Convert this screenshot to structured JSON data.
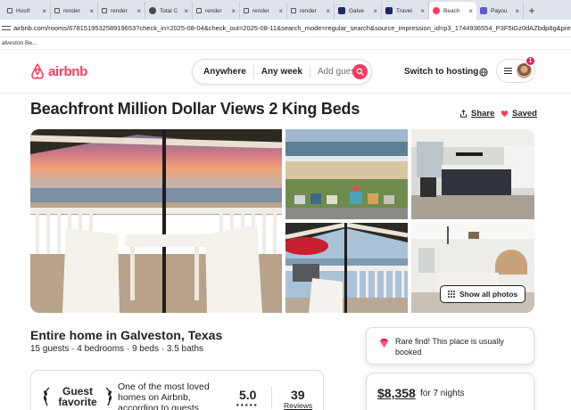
{
  "browser": {
    "tabs": [
      {
        "title": "Hostf",
        "icon": "lock-icon",
        "active": false
      },
      {
        "title": "render",
        "icon": "lock-icon",
        "active": false
      },
      {
        "title": "render",
        "icon": "lock-icon",
        "active": false
      },
      {
        "title": "Total C",
        "icon": "globe-icon",
        "active": false
      },
      {
        "title": "render",
        "icon": "lock-icon",
        "active": false
      },
      {
        "title": "render",
        "icon": "lock-icon",
        "active": false
      },
      {
        "title": "render",
        "icon": "lock-icon",
        "active": false
      },
      {
        "title": "Galve",
        "icon": "navy-logo-icon",
        "active": false
      },
      {
        "title": "Travel",
        "icon": "navy-logo-icon",
        "active": false
      },
      {
        "title": "Beach",
        "icon": "airbnb-icon",
        "active": true
      },
      {
        "title": "Payou",
        "icon": "v-logo-icon",
        "active": false
      }
    ],
    "url": "airbnb.com/rooms/678151953258919653?check_in=2025-08-04&check_out=2025-08-11&search_mode=regular_search&source_impression_id=p3_1744936554_P3F5iGz0dAZbdp8g&previous_pa...",
    "bookmark": "alveston Be..."
  },
  "header": {
    "logo_text": "airbnb",
    "search": {
      "anywhere": "Anywhere",
      "week": "Any week",
      "guests": "Add guests"
    },
    "host_link": "Switch to hosting",
    "notification_count": "1",
    "brand_color": "#ff385c"
  },
  "listing": {
    "title": "Beachfront Million Dollar Views 2 King Beds",
    "share_label": "Share",
    "saved_label": "Saved",
    "show_all_label": "Show all photos",
    "subtitle": "Entire home in Galveston, Texas",
    "details": "15 guests · 4 bedrooms · 9 beds · 3.5 baths"
  },
  "guest_favorite": {
    "badge_line1": "Guest",
    "badge_line2": "favorite",
    "description": "One of the most loved homes on Airbnb, according to guests",
    "rating": "5.0",
    "stars": "★★★★★",
    "review_count": "39",
    "reviews_label": "Reviews"
  },
  "rare_find": {
    "text": "Rare find! This place is usually booked"
  },
  "pricing": {
    "price": "$8,358",
    "note": "for 7 nights"
  }
}
